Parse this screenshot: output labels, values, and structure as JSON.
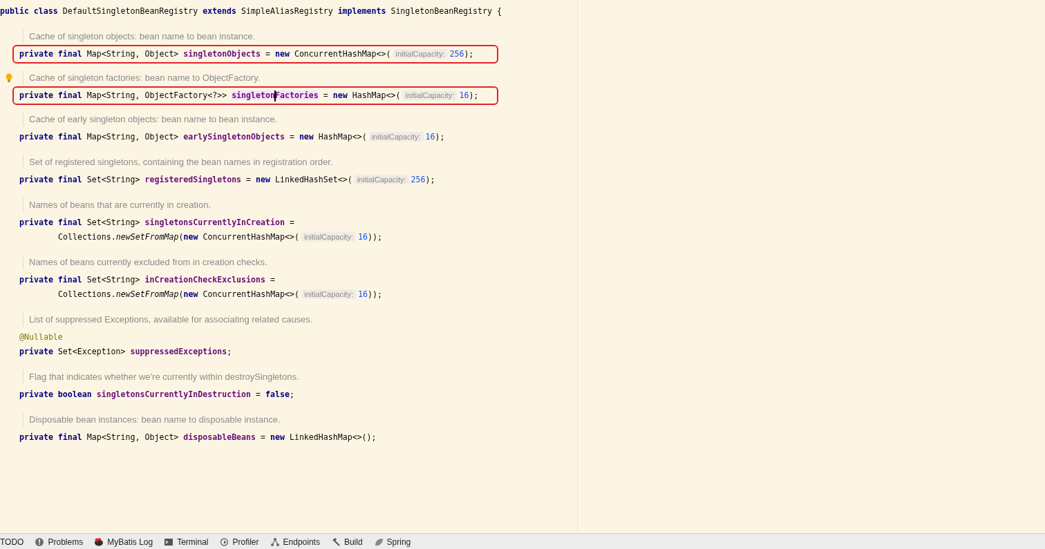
{
  "editor": {
    "blocks": [
      {
        "kind": "code",
        "boxed": false,
        "indent": false,
        "tokens": [
          {
            "t": "public class ",
            "kind": "kw",
            "highlight": false,
            "caret": false
          },
          {
            "t": "DefaultSingletonBeanRegistry ",
            "kind": "plain",
            "highlight": false,
            "caret": false
          },
          {
            "t": "extends ",
            "kind": "kw",
            "highlight": false,
            "caret": false
          },
          {
            "t": "SimpleAliasRegistry ",
            "kind": "plain",
            "highlight": false,
            "caret": false
          },
          {
            "t": "implements ",
            "kind": "kw",
            "highlight": false,
            "caret": false
          },
          {
            "t": "SingletonBeanRegistry {",
            "kind": "plain",
            "highlight": false,
            "caret": false
          }
        ]
      },
      {
        "kind": "doc",
        "bulb": false,
        "text": "Cache of singleton objects: bean name to bean instance."
      },
      {
        "kind": "code",
        "boxed": true,
        "indent": false,
        "tokens": [
          {
            "t": "private final ",
            "kind": "kw",
            "highlight": false,
            "caret": false
          },
          {
            "t": "Map<String, Object> ",
            "kind": "plain",
            "highlight": false,
            "caret": false
          },
          {
            "t": "singletonObjects",
            "kind": "field",
            "highlight": false,
            "caret": false
          },
          {
            "t": " = ",
            "kind": "plain",
            "highlight": false,
            "caret": false
          },
          {
            "t": "new ",
            "kind": "kw",
            "highlight": false,
            "caret": false
          },
          {
            "t": "ConcurrentHashMap<>(",
            "kind": "plain",
            "highlight": false,
            "caret": false
          },
          {
            "t": "initialCapacity:",
            "kind": "hint",
            "highlight": false,
            "caret": false
          },
          {
            "t": "256",
            "kind": "num",
            "highlight": false,
            "caret": false
          },
          {
            "t": ");",
            "kind": "plain",
            "highlight": false,
            "caret": false
          }
        ]
      },
      {
        "kind": "doc",
        "bulb": true,
        "text": "Cache of singleton factories: bean name to ObjectFactory."
      },
      {
        "kind": "code",
        "boxed": true,
        "indent": false,
        "tokens": [
          {
            "t": "private final ",
            "kind": "kw",
            "highlight": false,
            "caret": false
          },
          {
            "t": "Map<String, ObjectFactory<?>> ",
            "kind": "plain",
            "highlight": false,
            "caret": false
          },
          {
            "t": "singletonFactories",
            "kind": "field",
            "highlight": true,
            "caret": true
          },
          {
            "t": " = ",
            "kind": "plain",
            "highlight": false,
            "caret": false
          },
          {
            "t": "new ",
            "kind": "kw",
            "highlight": false,
            "caret": false
          },
          {
            "t": "HashMap<>(",
            "kind": "plain",
            "highlight": false,
            "caret": false
          },
          {
            "t": "initialCapacity:",
            "kind": "hint",
            "highlight": false,
            "caret": false
          },
          {
            "t": "16",
            "kind": "num",
            "highlight": false,
            "caret": false
          },
          {
            "t": ");",
            "kind": "plain",
            "highlight": false,
            "caret": false
          }
        ]
      },
      {
        "kind": "doc",
        "bulb": false,
        "text": "Cache of early singleton objects: bean name to bean instance."
      },
      {
        "kind": "code",
        "boxed": false,
        "indent": false,
        "tokens": [
          {
            "t": "private final ",
            "kind": "kw",
            "highlight": false,
            "caret": false
          },
          {
            "t": "Map<String, Object> ",
            "kind": "plain",
            "highlight": false,
            "caret": false
          },
          {
            "t": "earlySingletonObjects",
            "kind": "field",
            "highlight": false,
            "caret": false
          },
          {
            "t": " = ",
            "kind": "plain",
            "highlight": false,
            "caret": false
          },
          {
            "t": "new ",
            "kind": "kw",
            "highlight": false,
            "caret": false
          },
          {
            "t": "HashMap<>(",
            "kind": "plain",
            "highlight": false,
            "caret": false
          },
          {
            "t": "initialCapacity:",
            "kind": "hint",
            "highlight": false,
            "caret": false
          },
          {
            "t": "16",
            "kind": "num",
            "highlight": false,
            "caret": false
          },
          {
            "t": ");",
            "kind": "plain",
            "highlight": false,
            "caret": false
          }
        ]
      },
      {
        "kind": "doc",
        "bulb": false,
        "text": "Set of registered singletons, containing the bean names in registration order."
      },
      {
        "kind": "code",
        "boxed": false,
        "indent": false,
        "tokens": [
          {
            "t": "private final ",
            "kind": "kw",
            "highlight": false,
            "caret": false
          },
          {
            "t": "Set<String> ",
            "kind": "plain",
            "highlight": false,
            "caret": false
          },
          {
            "t": "registeredSingletons",
            "kind": "field",
            "highlight": false,
            "caret": false
          },
          {
            "t": " = ",
            "kind": "plain",
            "highlight": false,
            "caret": false
          },
          {
            "t": "new ",
            "kind": "kw",
            "highlight": false,
            "caret": false
          },
          {
            "t": "LinkedHashSet<>(",
            "kind": "plain",
            "highlight": false,
            "caret": false
          },
          {
            "t": "initialCapacity:",
            "kind": "hint",
            "highlight": false,
            "caret": false
          },
          {
            "t": "256",
            "kind": "num",
            "highlight": false,
            "caret": false
          },
          {
            "t": ");",
            "kind": "plain",
            "highlight": false,
            "caret": false
          }
        ]
      },
      {
        "kind": "doc",
        "bulb": false,
        "text": "Names of beans that are currently in creation."
      },
      {
        "kind": "code",
        "boxed": false,
        "indent": false,
        "tokens": [
          {
            "t": "private final ",
            "kind": "kw",
            "highlight": false,
            "caret": false
          },
          {
            "t": "Set<String> ",
            "kind": "plain",
            "highlight": false,
            "caret": false
          },
          {
            "t": "singletonsCurrentlyInCreation",
            "kind": "field",
            "highlight": false,
            "caret": false
          },
          {
            "t": " =",
            "kind": "plain",
            "highlight": false,
            "caret": false
          }
        ]
      },
      {
        "kind": "code",
        "boxed": false,
        "indent": true,
        "tokens": [
          {
            "t": "Collections.",
            "kind": "plain",
            "highlight": false,
            "caret": false
          },
          {
            "t": "newSetFromMap",
            "kind": "italic",
            "highlight": false,
            "caret": false
          },
          {
            "t": "(",
            "kind": "plain",
            "highlight": false,
            "caret": false
          },
          {
            "t": "new ",
            "kind": "kw",
            "highlight": false,
            "caret": false
          },
          {
            "t": "ConcurrentHashMap<>(",
            "kind": "plain",
            "highlight": false,
            "caret": false
          },
          {
            "t": "initialCapacity:",
            "kind": "hint",
            "highlight": false,
            "caret": false
          },
          {
            "t": "16",
            "kind": "num",
            "highlight": false,
            "caret": false
          },
          {
            "t": "));",
            "kind": "plain",
            "highlight": false,
            "caret": false
          }
        ]
      },
      {
        "kind": "doc",
        "bulb": false,
        "text": "Names of beans currently excluded from in creation checks."
      },
      {
        "kind": "code",
        "boxed": false,
        "indent": false,
        "tokens": [
          {
            "t": "private final ",
            "kind": "kw",
            "highlight": false,
            "caret": false
          },
          {
            "t": "Set<String> ",
            "kind": "plain",
            "highlight": false,
            "caret": false
          },
          {
            "t": "inCreationCheckExclusions",
            "kind": "field",
            "highlight": false,
            "caret": false
          },
          {
            "t": " =",
            "kind": "plain",
            "highlight": false,
            "caret": false
          }
        ]
      },
      {
        "kind": "code",
        "boxed": false,
        "indent": true,
        "tokens": [
          {
            "t": "Collections.",
            "kind": "plain",
            "highlight": false,
            "caret": false
          },
          {
            "t": "newSetFromMap",
            "kind": "italic",
            "highlight": false,
            "caret": false
          },
          {
            "t": "(",
            "kind": "plain",
            "highlight": false,
            "caret": false
          },
          {
            "t": "new ",
            "kind": "kw",
            "highlight": false,
            "caret": false
          },
          {
            "t": "ConcurrentHashMap<>(",
            "kind": "plain",
            "highlight": false,
            "caret": false
          },
          {
            "t": "initialCapacity:",
            "kind": "hint",
            "highlight": false,
            "caret": false
          },
          {
            "t": "16",
            "kind": "num",
            "highlight": false,
            "caret": false
          },
          {
            "t": "));",
            "kind": "plain",
            "highlight": false,
            "caret": false
          }
        ]
      },
      {
        "kind": "doc",
        "bulb": false,
        "text": "List of suppressed Exceptions, available for associating related causes."
      },
      {
        "kind": "code",
        "boxed": false,
        "indent": false,
        "tokens": [
          {
            "t": "@Nullable",
            "kind": "ann",
            "highlight": false,
            "caret": false
          }
        ]
      },
      {
        "kind": "code",
        "boxed": false,
        "indent": false,
        "tokens": [
          {
            "t": "private ",
            "kind": "kw",
            "highlight": false,
            "caret": false
          },
          {
            "t": "Set<Exception> ",
            "kind": "plain",
            "highlight": false,
            "caret": false
          },
          {
            "t": "suppressedExceptions",
            "kind": "field",
            "highlight": false,
            "caret": false
          },
          {
            "t": ";",
            "kind": "plain",
            "highlight": false,
            "caret": false
          }
        ]
      },
      {
        "kind": "doc",
        "bulb": false,
        "text": "Flag that indicates whether we're currently within destroySingletons."
      },
      {
        "kind": "code",
        "boxed": false,
        "indent": false,
        "tokens": [
          {
            "t": "private boolean ",
            "kind": "kw",
            "highlight": false,
            "caret": false
          },
          {
            "t": "singletonsCurrentlyInDestruction",
            "kind": "field",
            "highlight": false,
            "caret": false
          },
          {
            "t": " = ",
            "kind": "plain",
            "highlight": false,
            "caret": false
          },
          {
            "t": "false",
            "kind": "kw",
            "highlight": false,
            "caret": false
          },
          {
            "t": ";",
            "kind": "plain",
            "highlight": false,
            "caret": false
          }
        ]
      },
      {
        "kind": "doc",
        "bulb": false,
        "text": "Disposable bean instances: bean name to disposable instance."
      },
      {
        "kind": "code",
        "boxed": false,
        "indent": false,
        "tokens": [
          {
            "t": "private final ",
            "kind": "kw",
            "highlight": false,
            "caret": false
          },
          {
            "t": "Map<String, Object> ",
            "kind": "plain",
            "highlight": false,
            "caret": false
          },
          {
            "t": "disposableBeans",
            "kind": "field",
            "highlight": false,
            "caret": false
          },
          {
            "t": " = ",
            "kind": "plain",
            "highlight": false,
            "caret": false
          },
          {
            "t": "new ",
            "kind": "kw",
            "highlight": false,
            "caret": false
          },
          {
            "t": "LinkedHashMap<>();",
            "kind": "plain",
            "highlight": false,
            "caret": false
          }
        ]
      }
    ]
  },
  "tool_window_bar": [
    {
      "label": "TODO"
    },
    {
      "label": "Problems"
    },
    {
      "label": "MyBatis Log"
    },
    {
      "label": "Terminal"
    },
    {
      "label": "Profiler"
    },
    {
      "label": "Endpoints"
    },
    {
      "label": "Build"
    },
    {
      "label": "Spring"
    }
  ]
}
